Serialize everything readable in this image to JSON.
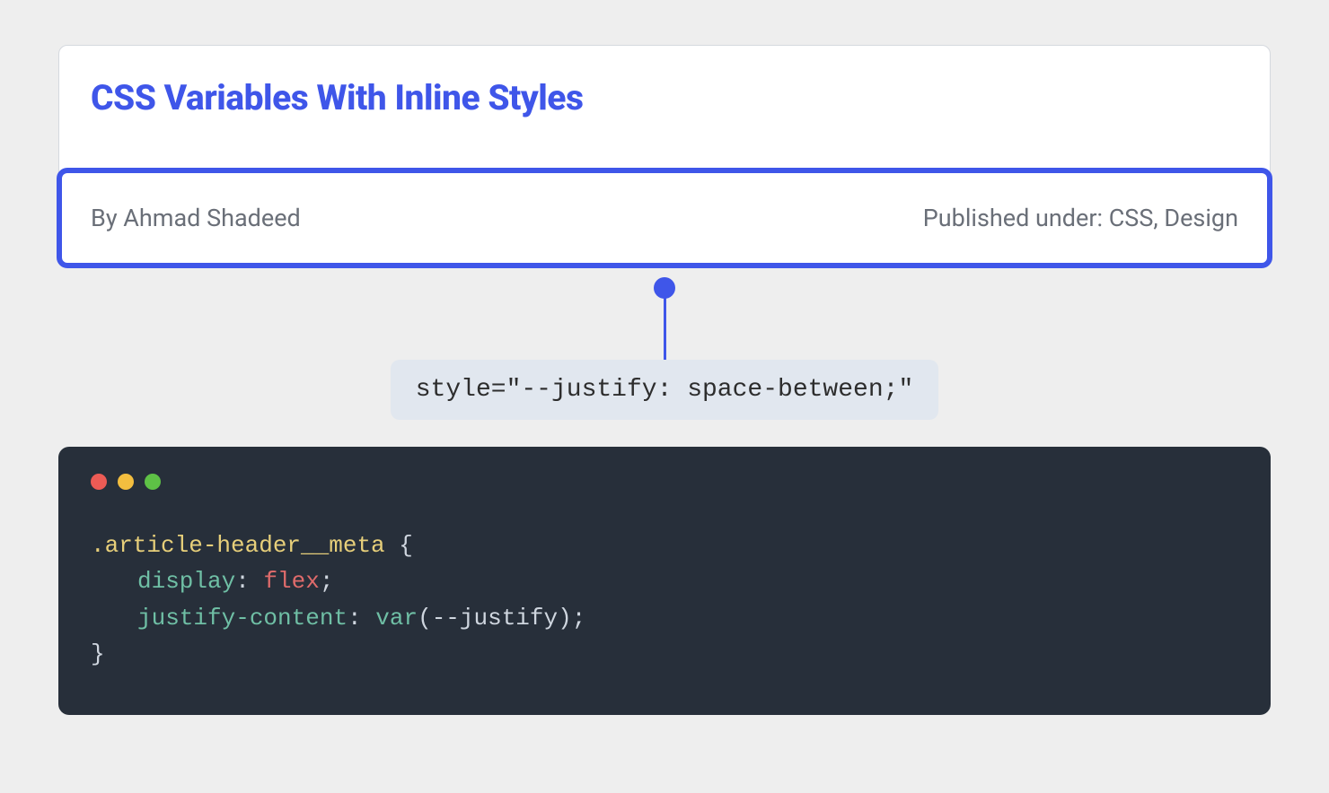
{
  "card": {
    "title": "CSS Variables With Inline Styles",
    "meta": {
      "author": "By Ahmad Shadeed",
      "published": "Published under: CSS, Design"
    }
  },
  "inline_style_label": "style=\"--justify: space-between;\"",
  "code": {
    "selector": ".article-header__meta",
    "open_brace": " {",
    "prop1": "display",
    "colon": ": ",
    "val1": "flex",
    "semi": ";",
    "prop2": "justify-content",
    "func": "var",
    "paren_open": "(",
    "var_name": "--justify",
    "paren_close": ")",
    "close_brace": "}"
  }
}
